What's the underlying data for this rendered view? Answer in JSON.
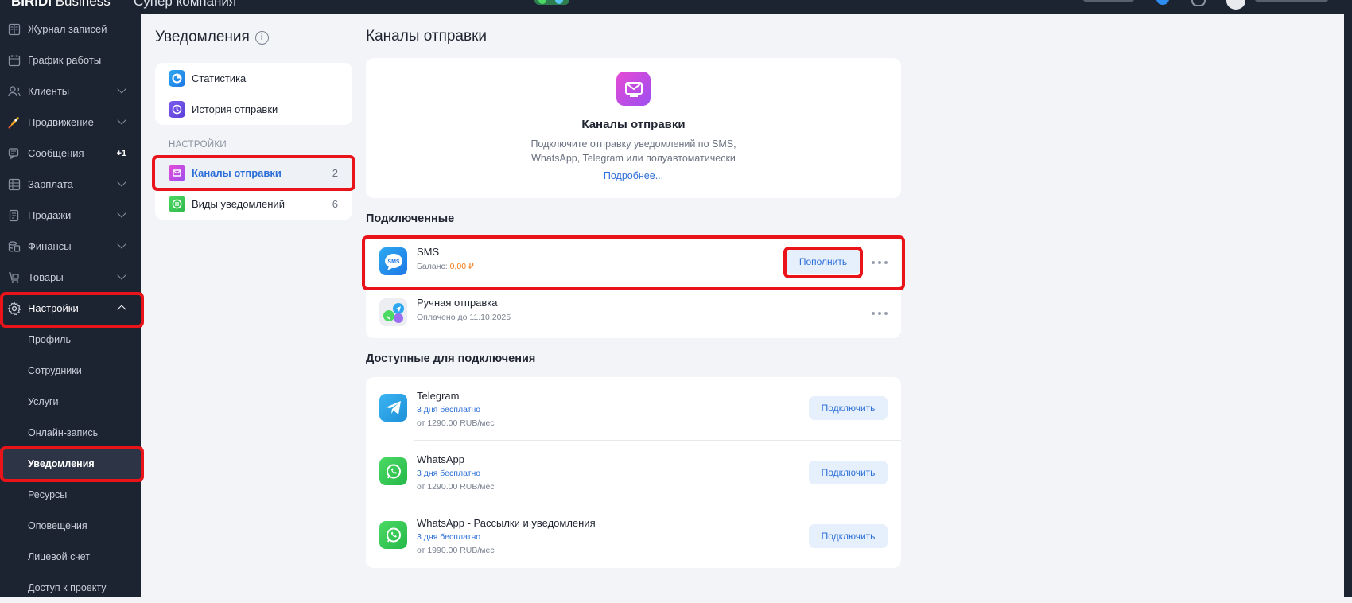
{
  "topbar": {
    "brand_bold": "BIRIDI",
    "brand_light": " Business",
    "company": "Супер компания"
  },
  "sidebar": {
    "items": [
      {
        "label": "Журнал записей",
        "icon": "journal-icon"
      },
      {
        "label": "График работы",
        "icon": "calendar-icon"
      },
      {
        "label": "Клиенты",
        "icon": "clients-icon"
      },
      {
        "label": "Продвижение",
        "icon": "rocket-icon"
      },
      {
        "label": "Сообщения",
        "icon": "messages-icon",
        "badge": "+1"
      },
      {
        "label": "Зарплата",
        "icon": "salary-icon"
      },
      {
        "label": "Продажи",
        "icon": "sales-icon"
      },
      {
        "label": "Финансы",
        "icon": "finance-icon"
      },
      {
        "label": "Товары",
        "icon": "goods-icon"
      },
      {
        "label": "Настройки",
        "icon": "gear-icon"
      }
    ],
    "sub_items": [
      "Профиль",
      "Сотрудники",
      "Услуги",
      "Онлайн-запись",
      "Уведомления",
      "Ресурсы",
      "Оповещения",
      "Лицевой счет",
      "Доступ к проекту"
    ]
  },
  "notifications": {
    "title": "Уведомления",
    "info_icon": "i",
    "menu_top": [
      {
        "label": "Статистика"
      },
      {
        "label": "История отправки"
      }
    ],
    "section_label": "НАСТРОЙКИ",
    "menu_settings": [
      {
        "label": "Каналы отправки",
        "count": "2"
      },
      {
        "label": "Виды уведомлений",
        "count": "6"
      }
    ]
  },
  "main": {
    "title": "Каналы отправки",
    "hero": {
      "title": "Каналы отправки",
      "desc_line1": "Подключите отправку уведомлений по SMS,",
      "desc_line2": "WhatsApp, Telegram или полуавтоматически",
      "link": "Подробнее..."
    },
    "connected_title": "Подключенные",
    "connected": {
      "sms_name": "SMS",
      "sms_balance_label": "Баланс: ",
      "sms_balance_value": "0,00 ₽",
      "sms_button": "Пополнить",
      "sms_icon_text": "SMS",
      "manual_name": "Ручная отправка",
      "manual_sub": "Оплачено до 11.10.2025"
    },
    "available_title": "Доступные для подключения",
    "available": [
      {
        "name": "Telegram",
        "trial": "3 дня бесплатно",
        "price": "от 1290.00 RUB/мес",
        "button": "Подключить",
        "icon": "telegram-icon"
      },
      {
        "name": "WhatsApp",
        "trial": "3 дня бесплатно",
        "price": "от 1290.00 RUB/мес",
        "button": "Подключить",
        "icon": "whatsapp-icon"
      },
      {
        "name": "WhatsApp - Рассылки и уведомления",
        "trial": "3 дня бесплатно",
        "price": "от 1990.00 RUB/мес",
        "button": "Подключить",
        "icon": "whatsapp-icon"
      }
    ]
  },
  "colors": {
    "sidebar_bg": "#1c2331",
    "accent": "#2d6fd8",
    "highlight": "#e8141a",
    "balance": "#f07a1a"
  }
}
